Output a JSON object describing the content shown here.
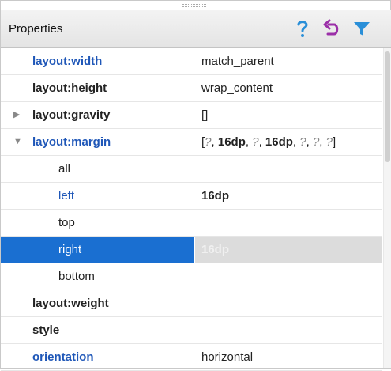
{
  "panel": {
    "title": "Properties",
    "toolbar": {
      "help_icon": "question-icon",
      "reset_icon": "undo-icon",
      "filter_icon": "filter-icon",
      "accent": "#2a8fd8",
      "reset_color": "#9b2fa8"
    }
  },
  "rows": [
    {
      "name": "layout:width",
      "value": "match_parent"
    },
    {
      "name": "layout:height",
      "value": "wrap_content"
    },
    {
      "name": "layout:gravity",
      "value": "[]",
      "arrow": "▶"
    },
    {
      "name": "layout:margin",
      "arrow": "▼",
      "value_parts": [
        "[",
        "?",
        ", ",
        "16dp",
        ", ",
        "?",
        ", ",
        "16dp",
        ", ",
        "?",
        ", ",
        "?",
        ", ",
        "?",
        "]"
      ]
    },
    {
      "name": "all",
      "value": ""
    },
    {
      "name": "left",
      "value": "16dp"
    },
    {
      "name": "top",
      "value": ""
    },
    {
      "name": "right",
      "value": "16dp",
      "selected": true
    },
    {
      "name": "bottom",
      "value": ""
    },
    {
      "name": "layout:weight",
      "value": ""
    },
    {
      "name": "style",
      "value": ""
    },
    {
      "name": "orientation",
      "value": "horizontal"
    }
  ],
  "colors": {
    "name_blue": "#1f57b8",
    "selection": "#1a6fd1"
  }
}
